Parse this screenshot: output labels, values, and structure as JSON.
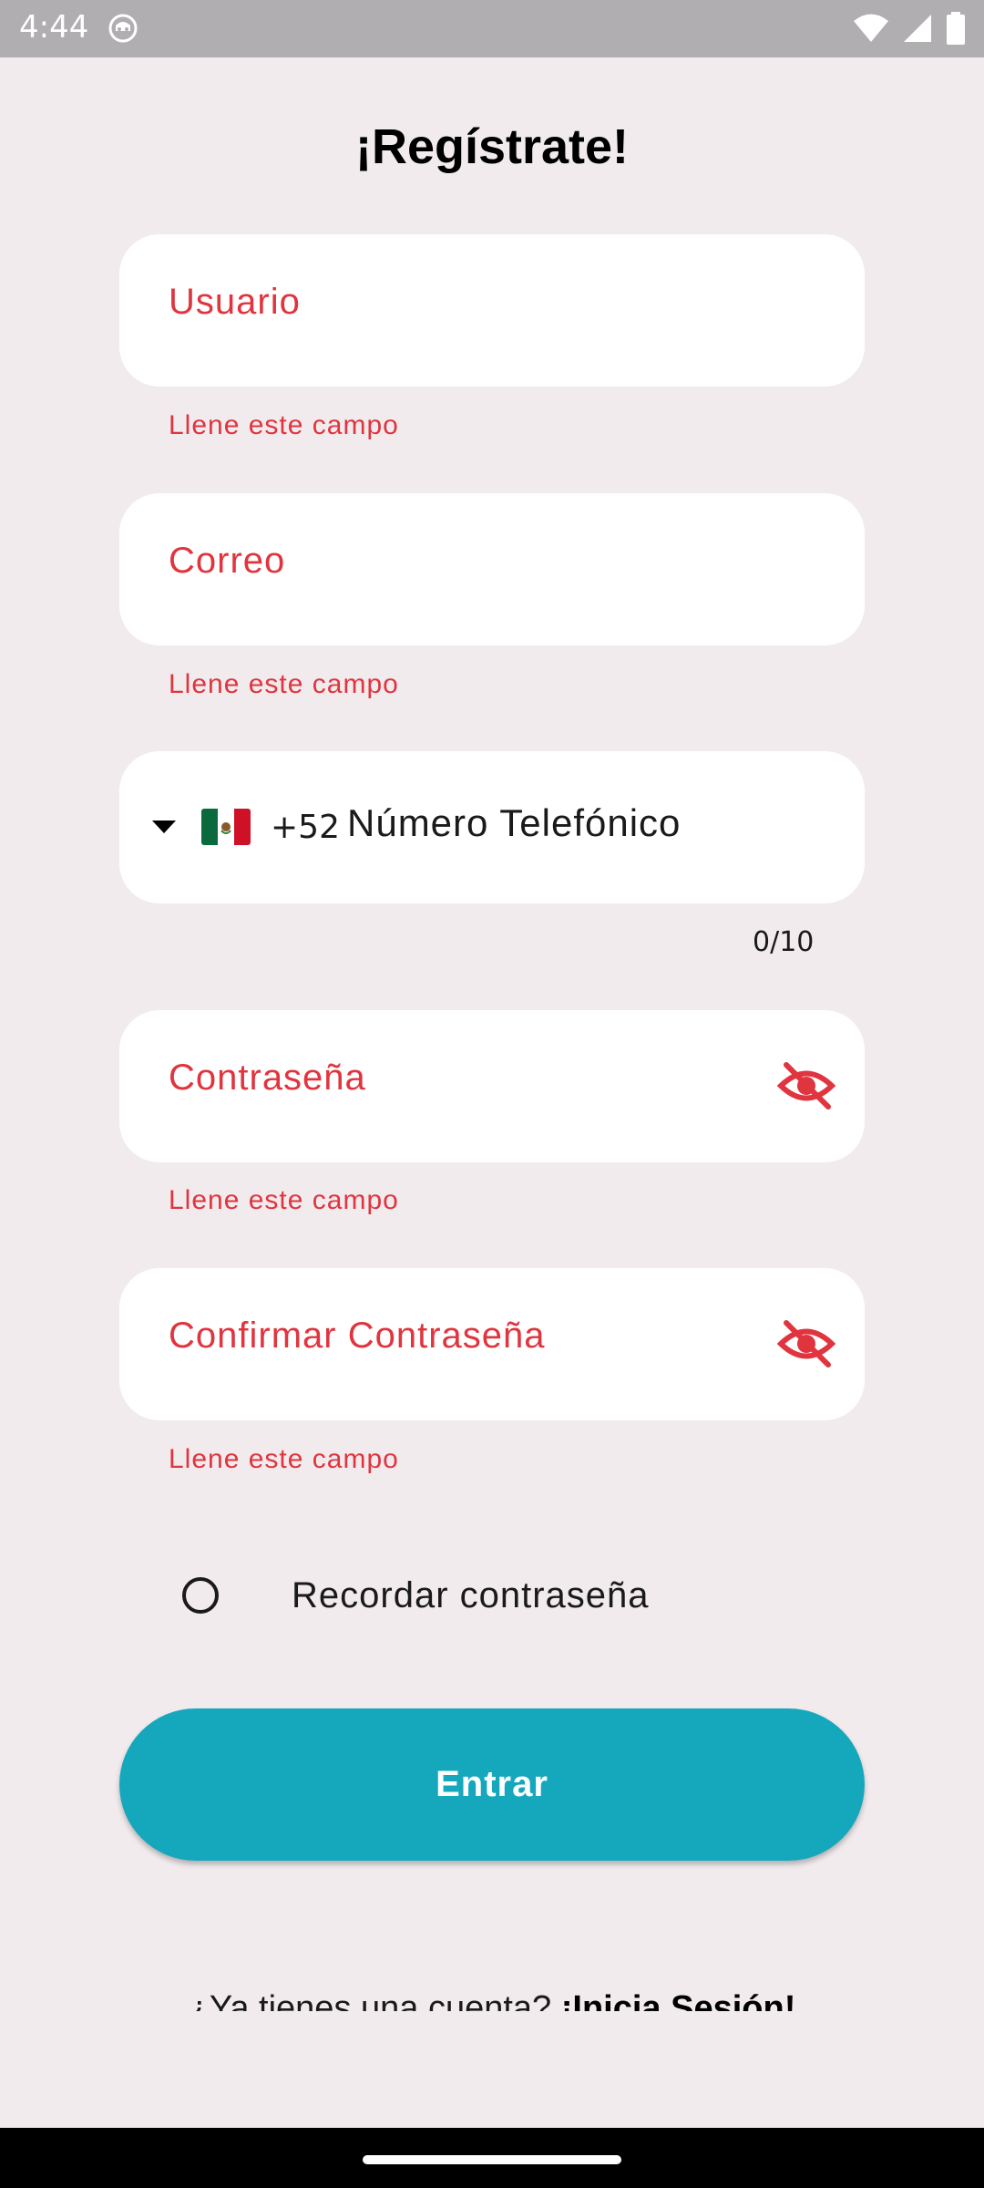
{
  "status_bar": {
    "time": "4:44",
    "icons": [
      "app-notification-icon",
      "wifi-icon",
      "signal-icon",
      "battery-icon"
    ]
  },
  "title": "¡Regístrate!",
  "colors": {
    "background": "#F1EBEE",
    "error": "#E0353F",
    "accent": "#15A8BD",
    "field_bg": "#FFFFFF"
  },
  "form": {
    "usuario": {
      "label": "Usuario",
      "error": "Llene este campo"
    },
    "correo": {
      "label": "Correo",
      "error": "Llene este campo"
    },
    "telefono": {
      "country_flag": "mexico-flag-icon",
      "dial_code": "+52",
      "placeholder": "Número Telefónico",
      "counter": "0/10"
    },
    "contrasena": {
      "label": "Contraseña",
      "error": "Llene este campo",
      "toggle_icon": "eye-off-icon"
    },
    "confirmar": {
      "label": "Confirmar Contraseña",
      "error": "Llene este campo",
      "toggle_icon": "eye-off-icon"
    },
    "remember": {
      "label": "Recordar contraseña",
      "checked": false
    },
    "submit_label": "Entrar"
  },
  "footer": {
    "prompt": "¿Ya tienes una cuenta? ",
    "link": "¡Inicia Sesión!"
  }
}
